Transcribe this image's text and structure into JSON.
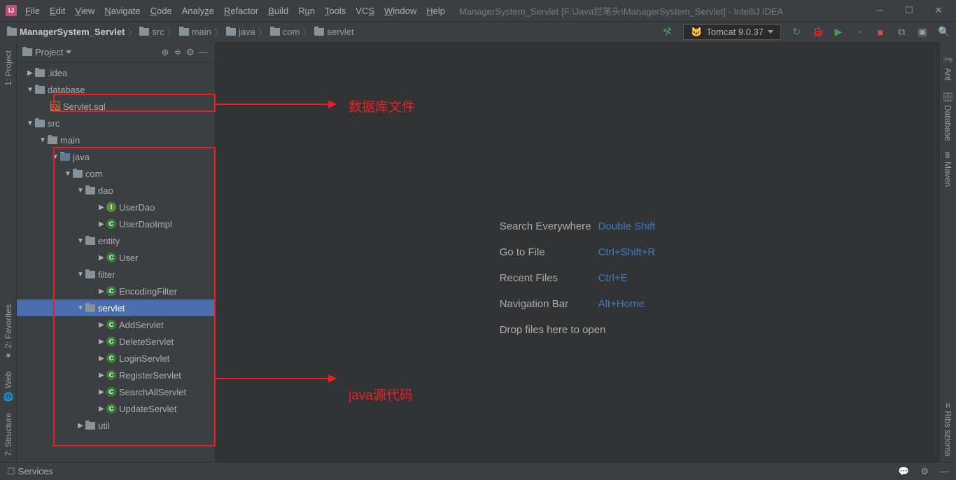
{
  "window": {
    "title": "ManagerSystem_Servlet [F:\\Java烂笔头\\ManagerSystem_Servlet] - IntelliJ IDEA"
  },
  "menu": [
    "File",
    "Edit",
    "View",
    "Navigate",
    "Code",
    "Analyze",
    "Refactor",
    "Build",
    "Run",
    "Tools",
    "VCS",
    "Window",
    "Help"
  ],
  "breadcrumb": [
    "ManagerSystem_Servlet",
    "src",
    "main",
    "java",
    "com",
    "servlet"
  ],
  "run_config": "Tomcat 9.0.37",
  "tree": {
    "header": "Project",
    "nodes": {
      "idea": ".idea",
      "database": "database",
      "sql": "Servlet.sql",
      "src": "src",
      "main": "main",
      "java": "java",
      "com": "com",
      "dao": "dao",
      "userdao": "UserDao",
      "userdaoimpl": "UserDaoImpl",
      "entity": "entity",
      "user": "User",
      "filter": "filter",
      "encodingfilter": "EncodingFilter",
      "servlet": "servlet",
      "addservlet": "AddServlet",
      "deleteservlet": "DeleteServlet",
      "loginservlet": "LoginServlet",
      "registerservlet": "RegisterServlet",
      "searchallservlet": "SearchAllServlet",
      "updateservlet": "UpdateServlet",
      "util": "util"
    }
  },
  "welcome": {
    "search": "Search Everywhere",
    "search_k": "Double Shift",
    "goto": "Go to File",
    "goto_k": "Ctrl+Shift+R",
    "recent": "Recent Files",
    "recent_k": "Ctrl+E",
    "nav": "Navigation Bar",
    "nav_k": "Alt+Home",
    "drop": "Drop files here to open"
  },
  "annotations": {
    "db": "数据库文件",
    "java": "java源代码"
  },
  "left_rail": {
    "project": "1: Project",
    "favorites": "2: Favorites",
    "web": "Web",
    "structure": "7: Structure"
  },
  "right_rail": {
    "ant": "Ant",
    "database": "Database",
    "maven": "Maven",
    "ribs": "Ribs szloma"
  },
  "status": {
    "services": "Services"
  }
}
